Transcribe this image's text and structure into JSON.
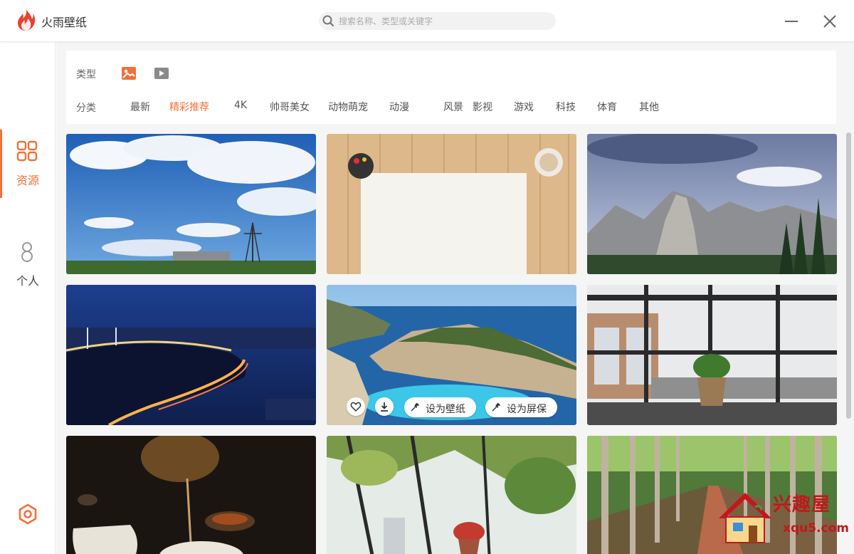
{
  "app": {
    "title": "火雨壁纸"
  },
  "search": {
    "placeholder": "搜索名称、类型或关键字",
    "value": ""
  },
  "sidebar": {
    "items": [
      {
        "label": "资源",
        "icon": "grid-icon",
        "active": true
      },
      {
        "label": "个人",
        "icon": "person-icon",
        "active": false
      }
    ],
    "settings_icon": "settings-icon"
  },
  "filters": {
    "type_label": "类型",
    "types": [
      {
        "icon": "image-icon",
        "active": true
      },
      {
        "icon": "video-icon",
        "active": false
      }
    ],
    "category_label": "分类",
    "categories": [
      "最新",
      "精彩推荐",
      "4K",
      "帅哥美女",
      "动物萌宠",
      "动漫",
      "风景",
      "影视",
      "游戏",
      "科技",
      "体育",
      "其他"
    ],
    "active_category": "精彩推荐"
  },
  "wallpapers": [
    {
      "subject": "power tower under blue sky"
    },
    {
      "subject": "wooden desk with paper and coffee"
    },
    {
      "subject": "mountain valley with cloudy sky"
    },
    {
      "subject": "night bridge city lights"
    },
    {
      "subject": "shipwreck beach cove"
    },
    {
      "subject": "potted plant on window sill"
    },
    {
      "subject": "tea pouring"
    },
    {
      "subject": "greenhouse plants"
    },
    {
      "subject": "tree lined path"
    }
  ],
  "card_actions": {
    "favorite_icon": "heart-icon",
    "download_icon": "download-icon",
    "set_wallpaper": "设为壁纸",
    "set_screensaver": "设为屏保"
  },
  "colors": {
    "accent": "#f0713a",
    "background": "#f5f5f5",
    "watermark": "#c4161c"
  },
  "watermark": {
    "text": "兴趣屋",
    "url": "xqu5.com"
  }
}
